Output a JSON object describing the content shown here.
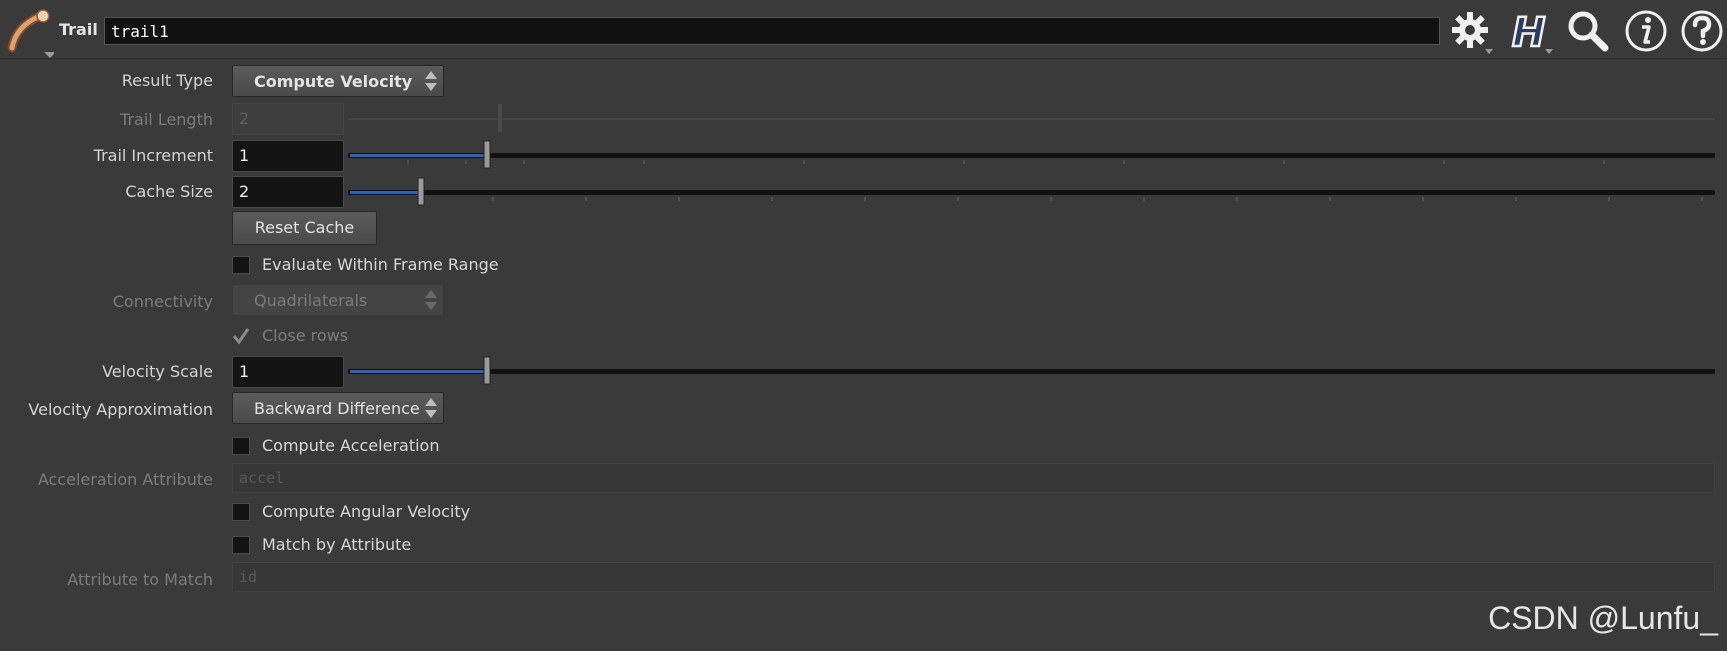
{
  "header": {
    "node_type": "Trail",
    "node_name": "trail1",
    "icons": [
      "gear-icon",
      "houdini-help-icon",
      "search-icon",
      "info-icon",
      "question-icon"
    ]
  },
  "parms": {
    "result_type": {
      "label": "Result Type",
      "value": "Compute Velocity"
    },
    "trail_length": {
      "label": "Trail Length",
      "value": "2"
    },
    "trail_increment": {
      "label": "Trail Increment",
      "value": "1",
      "slider_fraction": 0.1
    },
    "cache_size": {
      "label": "Cache Size",
      "value": "2",
      "slider_fraction": 0.053
    },
    "reset_cache": {
      "label": "Reset Cache"
    },
    "eval_frame_range": {
      "label": "Evaluate Within Frame Range",
      "checked": false
    },
    "connectivity": {
      "label": "Connectivity",
      "value": "Quadrilaterals"
    },
    "close_rows": {
      "label": "Close rows",
      "checked": true
    },
    "velocity_scale": {
      "label": "Velocity Scale",
      "value": "1",
      "slider_fraction": 0.1
    },
    "velocity_approx": {
      "label": "Velocity Approximation",
      "value": "Backward Difference"
    },
    "compute_accel": {
      "label": "Compute Acceleration",
      "checked": false
    },
    "accel_attr": {
      "label": "Acceleration Attribute",
      "value": "accel"
    },
    "compute_ang_vel": {
      "label": "Compute Angular Velocity",
      "checked": false
    },
    "match_by_attr": {
      "label": "Match by Attribute",
      "checked": false
    },
    "attr_to_match": {
      "label": "Attribute to Match",
      "value": "id"
    }
  },
  "watermark": "CSDN @Lunfu_",
  "colors": {
    "background": "#3a3a3a",
    "slider_fill": "#2d63b8",
    "field_bg": "#141414"
  }
}
